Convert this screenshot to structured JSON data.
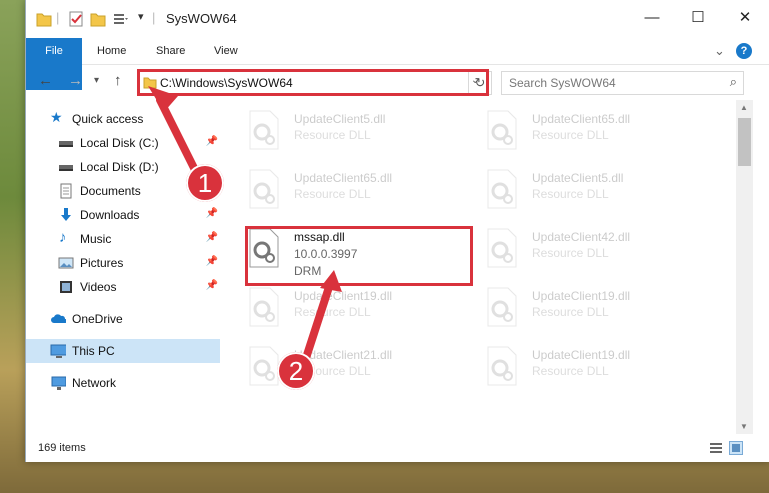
{
  "window": {
    "title": "SysWOW64",
    "minimize_glyph": "—",
    "maximize_glyph": "☐",
    "close_glyph": "✕"
  },
  "ribbon": {
    "tabs": [
      {
        "label": "File"
      },
      {
        "label": "Home"
      },
      {
        "label": "Share"
      },
      {
        "label": "View"
      }
    ],
    "help_glyph": "?",
    "expand_glyph": "⌄"
  },
  "address": {
    "path": "C:\\Windows\\SysWOW64",
    "search_placeholder": "Search SysWOW64"
  },
  "nav": {
    "items": [
      {
        "label": "Quick access",
        "icon": "star-icon",
        "pinned": false
      },
      {
        "label": "Local Disk (C:)",
        "icon": "drive-icon",
        "pinned": true
      },
      {
        "label": "Local Disk (D:)",
        "icon": "drive-icon",
        "pinned": false
      },
      {
        "label": "Documents",
        "icon": "documents-icon",
        "pinned": false
      },
      {
        "label": "Downloads",
        "icon": "downloads-icon",
        "pinned": true
      },
      {
        "label": "Music",
        "icon": "music-icon",
        "pinned": true
      },
      {
        "label": "Pictures",
        "icon": "pictures-icon",
        "pinned": true
      },
      {
        "label": "Videos",
        "icon": "videos-icon",
        "pinned": true
      },
      {
        "label": "OneDrive",
        "icon": "cloud-icon",
        "pinned": false
      },
      {
        "label": "This PC",
        "icon": "computer-icon",
        "pinned": false,
        "selected": true
      },
      {
        "label": "Network",
        "icon": "network-icon",
        "pinned": false
      }
    ]
  },
  "files": [
    {
      "name": "UpdateClient5.dll",
      "type": "Resource DLL"
    },
    {
      "name": "UpdateClient65.dll",
      "type": "Resource DLL"
    },
    {
      "name": "UpdateClient65.dll",
      "type": "Resource DLL"
    },
    {
      "name": "UpdateClient5.dll",
      "type": "Resource DLL"
    },
    {
      "name": "mssap.dll",
      "version": "10.0.0.3997",
      "type": "DRM",
      "highlighted": true
    },
    {
      "name": "UpdateClient42.dll",
      "type": "Resource DLL"
    },
    {
      "name": "UpdateClient19.dll",
      "type": "Resource DLL"
    },
    {
      "name": "UpdateClient19.dll",
      "type": "Resource DLL"
    },
    {
      "name": "UpdateClient21.dll",
      "type": "Resource DLL"
    },
    {
      "name": "UpdateClient19.dll",
      "type": "Resource DLL"
    }
  ],
  "status": {
    "item_count": "169 items"
  },
  "callouts": [
    {
      "number": "1"
    },
    {
      "number": "2"
    }
  ],
  "colors": {
    "accent": "#1979ca",
    "highlight_red": "#d9323c",
    "selection": "#cce4f7"
  }
}
